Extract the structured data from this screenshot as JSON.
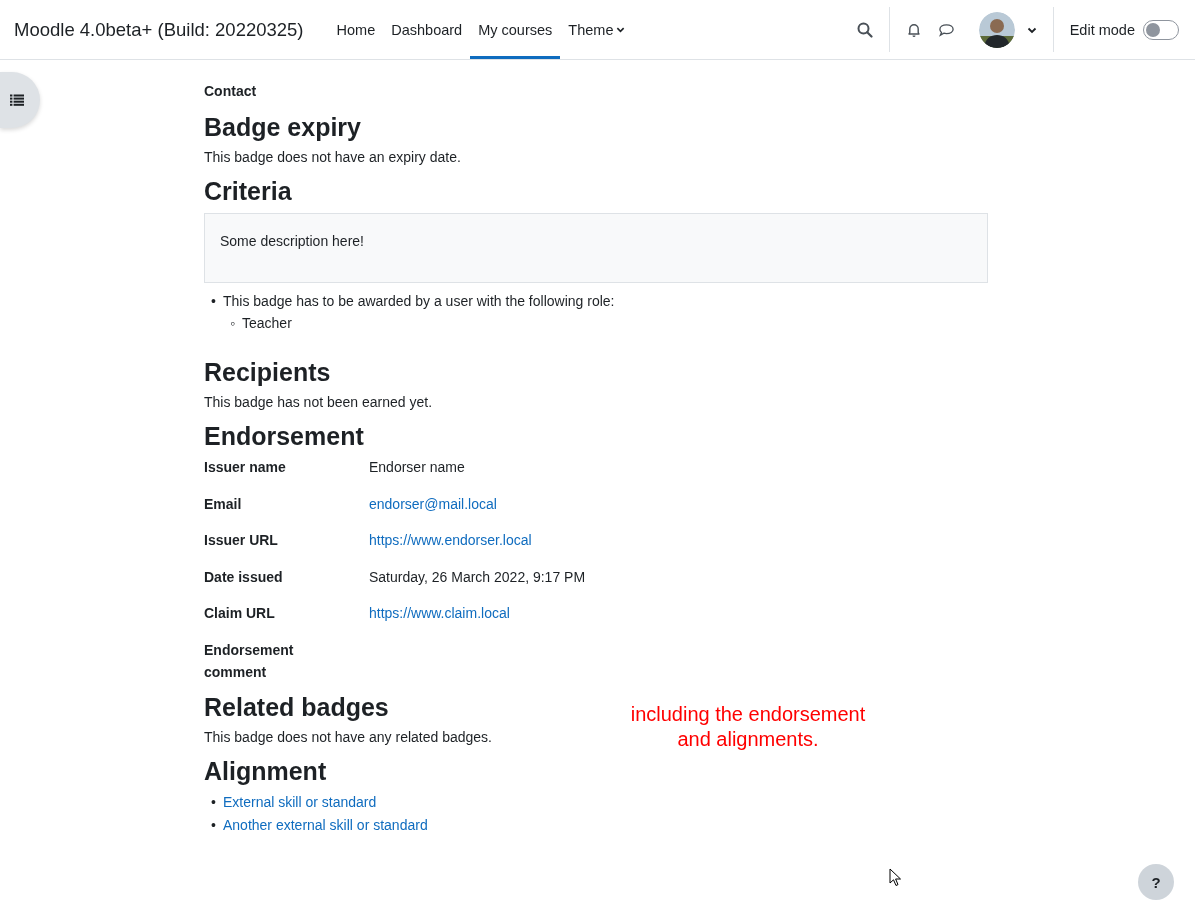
{
  "header": {
    "site_name": "Moodle 4.0beta+ (Build: 20220325)",
    "nav": [
      {
        "label": "Home",
        "selected": false,
        "has_menu": false
      },
      {
        "label": "Dashboard",
        "selected": false,
        "has_menu": false
      },
      {
        "label": "My courses",
        "selected": true,
        "has_menu": false
      },
      {
        "label": "Theme",
        "selected": false,
        "has_menu": true
      }
    ],
    "edit_mode": {
      "label": "Edit mode",
      "on": false
    }
  },
  "contact_label": "Contact",
  "badge_expiry": {
    "heading": "Badge expiry",
    "text": "This badge does not have an expiry date."
  },
  "criteria": {
    "heading": "Criteria",
    "description": "Some description here!",
    "items": [
      {
        "marker": "•",
        "text": "This badge has to be awarded by a user with the following role:",
        "children": [
          {
            "marker": "◦",
            "text": "Teacher"
          }
        ]
      }
    ]
  },
  "recipients": {
    "heading": "Recipients",
    "text": "This badge has not been earned yet."
  },
  "endorsement": {
    "heading": "Endorsement",
    "rows": [
      {
        "label": "Issuer name",
        "value": "Endorser name",
        "kind": "text"
      },
      {
        "label": "Email",
        "value": "endorser@mail.local",
        "kind": "link"
      },
      {
        "label": "Issuer URL",
        "value": "https://www.endorser.local",
        "kind": "link"
      },
      {
        "label": "Date issued",
        "value": "Saturday, 26 March 2022, 9:17 PM",
        "kind": "text"
      },
      {
        "label": "Claim URL",
        "value": "https://www.claim.local",
        "kind": "link"
      },
      {
        "label": "Endorsement comment"
      }
    ]
  },
  "related_badges": {
    "heading": "Related badges",
    "text": "This badge does not have any related badges."
  },
  "alignment": {
    "heading": "Alignment",
    "links": [
      {
        "marker": "•",
        "text": "External skill or standard"
      },
      {
        "marker": "•",
        "text": "Another external skill or standard"
      }
    ]
  },
  "annotation": "including the endorsement and alignments.",
  "help_button": "?"
}
